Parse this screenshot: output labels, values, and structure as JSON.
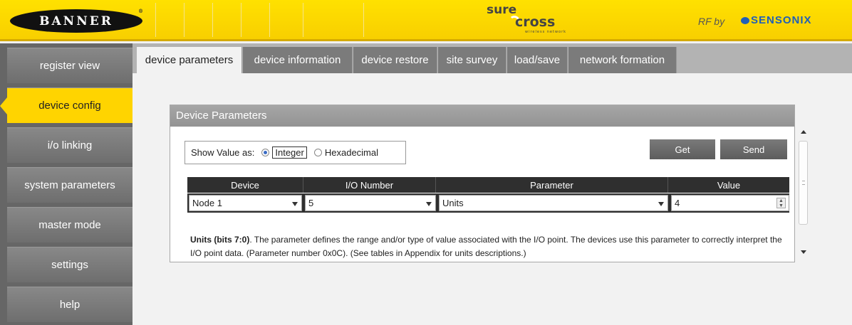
{
  "header": {
    "banner_logo": "BANNER",
    "banner_reg": "®",
    "surecross_line1": "sure",
    "surecross_line2": "cross",
    "surecross_tagline": "wireless network",
    "rf_by": "RF by",
    "sensonix": "SENSONIX"
  },
  "sidebar": {
    "items": [
      {
        "label": "register view",
        "active": false
      },
      {
        "label": "device config",
        "active": true
      },
      {
        "label": "i/o linking",
        "active": false
      },
      {
        "label": "system parameters",
        "active": false
      },
      {
        "label": "master mode",
        "active": false
      },
      {
        "label": "settings",
        "active": false
      },
      {
        "label": "help",
        "active": false
      }
    ]
  },
  "tabs": [
    {
      "label": "device parameters",
      "active": true
    },
    {
      "label": "device information",
      "active": false
    },
    {
      "label": "device restore",
      "active": false
    },
    {
      "label": "site survey",
      "active": false
    },
    {
      "label": "load/save",
      "active": false
    },
    {
      "label": "network formation",
      "active": false
    }
  ],
  "panel": {
    "title": "Device Parameters",
    "show_value_label": "Show Value as:",
    "option_integer": "Integer",
    "option_hex": "Hexadecimal",
    "selected_option": "Integer",
    "get_button": "Get",
    "send_button": "Send",
    "table": {
      "headers": [
        "Device",
        "I/O Number",
        "Parameter",
        "Value"
      ],
      "row": {
        "device": "Node 1",
        "io_number": "5",
        "parameter": "Units",
        "value": "4"
      }
    },
    "description_bold": "Units (bits 7:0)",
    "description_text": ". The parameter defines the range and/or type of value associated with the I/O point. The devices use this parameter to correctly interpret the I/O point data. (Parameter number 0x0C). (See tables in Appendix for units descriptions.)"
  },
  "colors": {
    "header_yellow": "#ffd400",
    "sidebar_gray": "#7a7a7a",
    "active_yellow": "#ffd400",
    "table_header": "#2f2f2f"
  }
}
